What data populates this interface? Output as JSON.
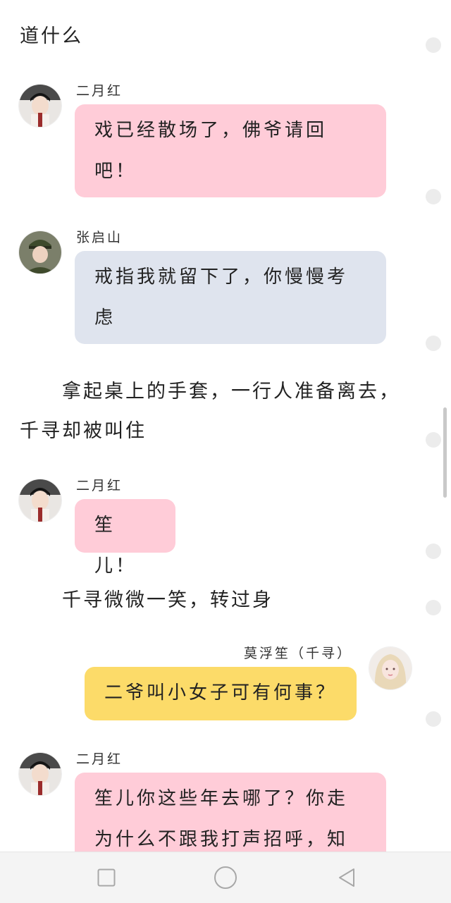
{
  "narration": {
    "top": "道什么",
    "mid_line1": "拿起桌上的手套，一行人准备离去，",
    "mid_line2": "千寻却被叫住",
    "smile": "千寻微微一笑，转过身"
  },
  "messages": [
    {
      "speaker": "二月红",
      "line1": "戏已经散场了，佛爷请回",
      "line2": "吧！"
    },
    {
      "speaker": "张启山",
      "line1": "戒指我就留下了，你慢慢考",
      "line2": "虑"
    },
    {
      "speaker": "二月红",
      "line1": "笙儿！"
    },
    {
      "speaker": "莫浮笙（千寻）",
      "line1": "二爷叫小女子可有何事？"
    },
    {
      "speaker": "二月红",
      "line1": "笙儿你这些年去哪了？你走",
      "line2": "为什么不跟我打声招呼，知"
    }
  ],
  "avatars": {
    "er_yue_hong": "avatar-er-yue-hong",
    "zhang_qi_shan": "avatar-zhang-qi-shan",
    "qian_xun": "avatar-qian-xun"
  },
  "colors": {
    "pink_bubble": "#ffccd8",
    "blue_bubble": "#dfe4ee",
    "yellow_bubble": "#fcdb69"
  },
  "navbar": {
    "recent": "square-icon",
    "home": "circle-icon",
    "back": "triangle-back-icon"
  }
}
